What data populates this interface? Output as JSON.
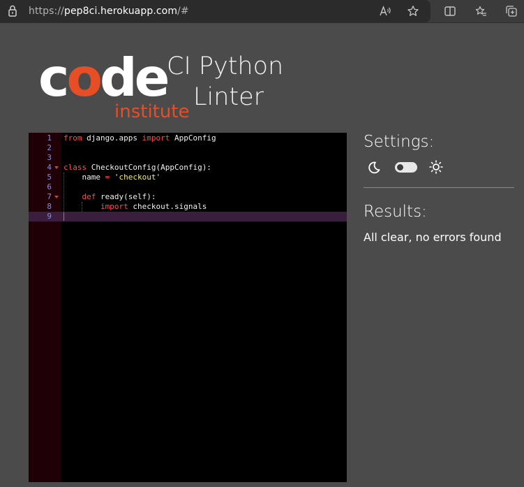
{
  "browser": {
    "url_prefix": "https://",
    "url_host": "pep8ci.herokuapp.com",
    "url_suffix": "/#",
    "icons": [
      "lock-icon",
      "read-aloud-icon",
      "favorite-star-icon",
      "split-screen-icon",
      "favorites-icon",
      "collections-icon"
    ]
  },
  "header": {
    "logo_word": "code",
    "logo_sub": "institute",
    "title_line1": "CI Python",
    "title_line2": "Linter"
  },
  "editor": {
    "lines": [
      {
        "num": "1",
        "fold": false,
        "tokens": [
          {
            "t": "from",
            "c": "kw"
          },
          {
            "t": " django.apps ",
            "c": ""
          },
          {
            "t": "import",
            "c": "kw"
          },
          {
            "t": " AppConfig",
            "c": ""
          }
        ]
      },
      {
        "num": "2",
        "fold": false,
        "tokens": []
      },
      {
        "num": "3",
        "fold": false,
        "tokens": []
      },
      {
        "num": "4",
        "fold": true,
        "tokens": [
          {
            "t": "class",
            "c": "kw"
          },
          {
            "t": " CheckoutConfig(AppConfig):",
            "c": ""
          }
        ]
      },
      {
        "num": "5",
        "fold": false,
        "tokens": [
          {
            "t": "    name ",
            "c": ""
          },
          {
            "t": "=",
            "c": "kw"
          },
          {
            "t": " ",
            "c": ""
          },
          {
            "t": "'checkout'",
            "c": "str"
          }
        ]
      },
      {
        "num": "6",
        "fold": false,
        "tokens": []
      },
      {
        "num": "7",
        "fold": true,
        "tokens": [
          {
            "t": "    ",
            "c": ""
          },
          {
            "t": "def",
            "c": "kw"
          },
          {
            "t": " ready(self):",
            "c": ""
          }
        ]
      },
      {
        "num": "8",
        "fold": false,
        "tokens": [
          {
            "t": "        ",
            "c": ""
          },
          {
            "t": "import",
            "c": "kw"
          },
          {
            "t": " checkout.signals",
            "c": ""
          }
        ]
      },
      {
        "num": "9",
        "fold": false,
        "active": true,
        "tokens": []
      }
    ]
  },
  "settings": {
    "title": "Settings:",
    "theme_toggle_on": false
  },
  "results": {
    "title": "Results:",
    "message": "All clear, no errors found"
  },
  "colors": {
    "page_bg": "#4b4b4b",
    "editor_bg": "#000000",
    "gutter_bg": "#1f0006",
    "keyword": "#ff4d4d",
    "string": "#f6ed6c",
    "logo_accent": "#e84e25"
  }
}
